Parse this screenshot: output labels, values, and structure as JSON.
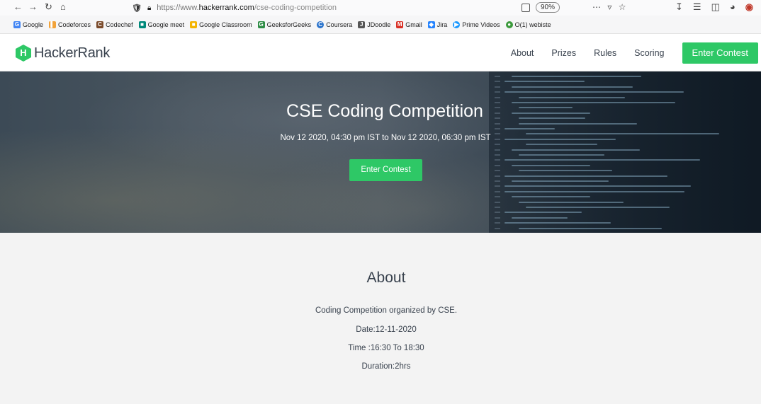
{
  "browser": {
    "url_prefix": "https://www.",
    "url_host": "hackerrank.com",
    "url_path": "/cse-coding-competition",
    "zoom": "90%",
    "page_actions": "⋯ ▿ ☆"
  },
  "bookmarks": [
    {
      "label": "Google",
      "icon": "G",
      "color": "#4285f4"
    },
    {
      "label": "Codeforces",
      "icon": "▌",
      "color": "#f2a33a"
    },
    {
      "label": "Codechef",
      "icon": "C",
      "color": "#7a4a2a"
    },
    {
      "label": "Google meet",
      "icon": "■",
      "color": "#00897b"
    },
    {
      "label": "Google Classroom",
      "icon": "■",
      "color": "#f4b400"
    },
    {
      "label": "GeeksforGeeks",
      "icon": "G",
      "color": "#2f8d46"
    },
    {
      "label": "Coursera",
      "icon": "C",
      "color": "#2a73cc"
    },
    {
      "label": "JDoodle",
      "icon": "J",
      "color": "#555555"
    },
    {
      "label": "Gmail",
      "icon": "M",
      "color": "#d93025"
    },
    {
      "label": "Jira",
      "icon": "◆",
      "color": "#2684ff"
    },
    {
      "label": "Prime Videos",
      "icon": "▶",
      "color": "#1a98ff"
    },
    {
      "label": "O(1) webiste",
      "icon": "●",
      "color": "#3c9a3c"
    }
  ],
  "header": {
    "logo_letter": "H",
    "brand": "HackerRank",
    "nav": [
      "About",
      "Prizes",
      "Rules",
      "Scoring"
    ],
    "cta": "Enter Contest"
  },
  "hero": {
    "title": "CSE Coding Competition",
    "date": "Nov 12 2020, 04:30 pm IST to Nov 12 2020, 06:30 pm IST",
    "cta": "Enter Contest"
  },
  "about": {
    "title": "About",
    "lines": [
      "Coding Competition organized by CSE.",
      "Date:12-11-2020",
      "Time :16:30 To 18:30",
      "Duration:2hrs"
    ]
  },
  "colors": {
    "accent": "#2ec866",
    "text": "#39424e",
    "about_bg": "#f3f3f3"
  }
}
